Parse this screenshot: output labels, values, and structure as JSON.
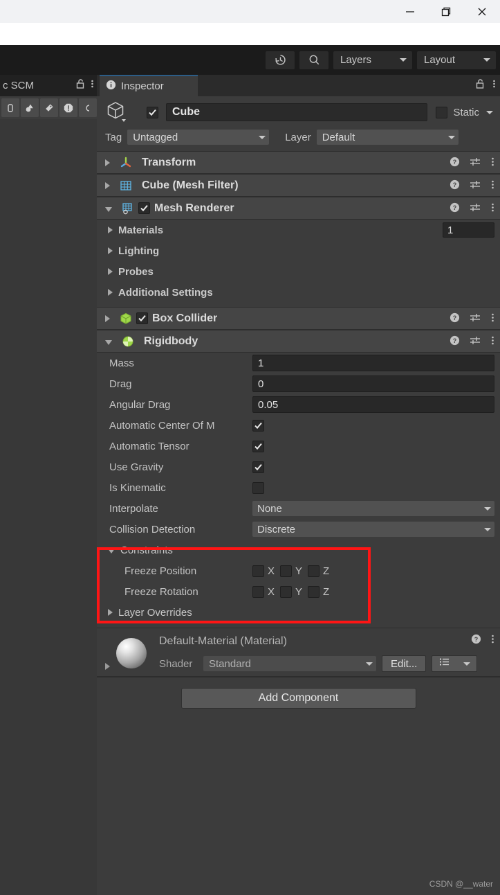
{
  "window_controls": {
    "minimize": "minimize-icon",
    "restore": "restore-icon",
    "close": "close-icon"
  },
  "toolbar": {
    "history_icon": "history-icon",
    "search_icon": "search-icon",
    "layers_label": "Layers",
    "layout_label": "Layout"
  },
  "left_panel": {
    "tab_label": "c SCM",
    "lock_icon": "lock-open-icon",
    "menu_icon": "kebab-menu-icon"
  },
  "inspector": {
    "tab_label": "Inspector",
    "tab_icon": "info-icon",
    "lock_icon": "lock-open-icon",
    "menu_icon": "kebab-menu-icon"
  },
  "gameobject": {
    "icon": "cube-icon",
    "enabled": true,
    "name": "Cube",
    "static_label": "Static",
    "static_checked": false,
    "tag_label": "Tag",
    "tag_value": "Untagged",
    "layer_label": "Layer",
    "layer_value": "Default"
  },
  "components": [
    {
      "name": "Transform",
      "icon": "transform-icon",
      "expanded": false,
      "has_toggle": false
    },
    {
      "name": "Cube (Mesh Filter)",
      "icon": "mesh-filter-icon",
      "expanded": false,
      "has_toggle": false
    },
    {
      "name": "Mesh Renderer",
      "icon": "mesh-renderer-icon",
      "expanded": true,
      "has_toggle": true,
      "enabled": true
    },
    {
      "name": "Box Collider",
      "icon": "box-collider-icon",
      "expanded": false,
      "has_toggle": true,
      "enabled": true
    },
    {
      "name": "Rigidbody",
      "icon": "rigidbody-icon",
      "expanded": true,
      "has_toggle": false
    }
  ],
  "mesh_renderer": {
    "sections": [
      {
        "label": "Materials",
        "count": "1"
      },
      {
        "label": "Lighting"
      },
      {
        "label": "Probes"
      },
      {
        "label": "Additional Settings"
      }
    ]
  },
  "rigidbody": {
    "mass_label": "Mass",
    "mass_value": "1",
    "drag_label": "Drag",
    "drag_value": "0",
    "angular_drag_label": "Angular Drag",
    "angular_drag_value": "0.05",
    "auto_center_label": "Automatic Center Of M",
    "auto_center_checked": true,
    "auto_tensor_label": "Automatic Tensor",
    "auto_tensor_checked": true,
    "use_gravity_label": "Use Gravity",
    "use_gravity_checked": true,
    "is_kinematic_label": "Is Kinematic",
    "is_kinematic_checked": false,
    "interpolate_label": "Interpolate",
    "interpolate_value": "None",
    "collision_label": "Collision Detection",
    "collision_value": "Discrete",
    "constraints_label": "Constraints",
    "freeze_position_label": "Freeze Position",
    "freeze_rotation_label": "Freeze Rotation",
    "axis_x": "X",
    "axis_y": "Y",
    "axis_z": "Z",
    "layer_overrides_label": "Layer Overrides",
    "highlight_color": "#ff1515"
  },
  "material": {
    "title": "Default-Material (Material)",
    "shader_label": "Shader",
    "shader_value": "Standard",
    "edit_label": "Edit...",
    "help_icon": "help-icon",
    "menu_icon": "kebab-menu-icon",
    "preset_icon": "preset-list-icon"
  },
  "add_component": {
    "label": "Add Component"
  },
  "watermark": {
    "text": "CSDN @__water"
  }
}
